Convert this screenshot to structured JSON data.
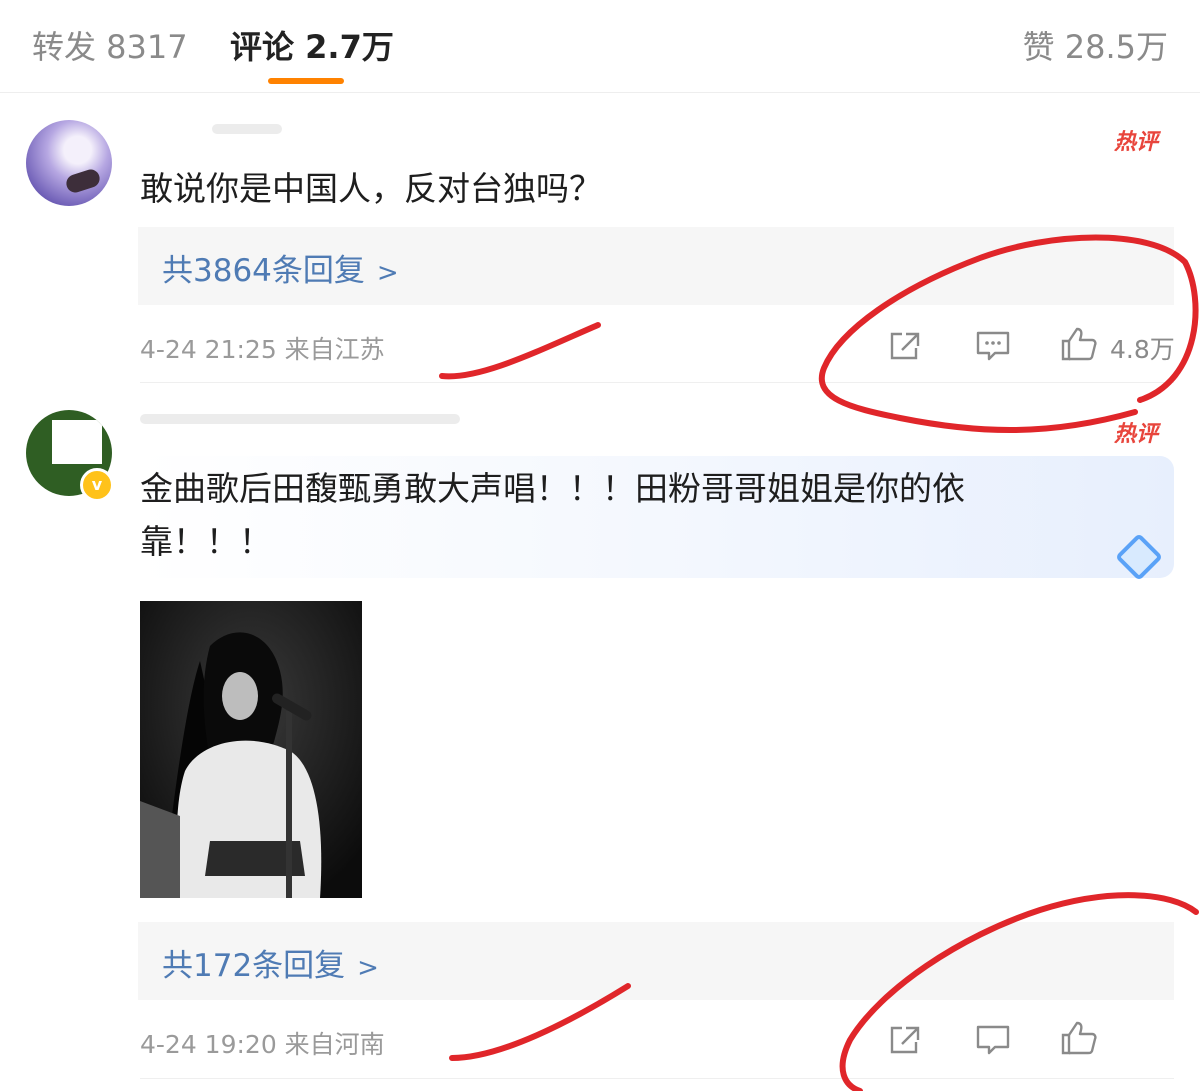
{
  "tabs": {
    "repost": "转发 8317",
    "comments": "评论 2.7万",
    "likes": "赞 28.5万"
  },
  "accent_color": "#ff8200",
  "link_color": "#4f7bb4",
  "annotation_color": "#e0262a",
  "comments": [
    {
      "badge": "热评",
      "text": "敢说你是中国人，反对台独吗？",
      "replies_label": "共3864条回复",
      "time_location": "4-24 21:25 来自江苏",
      "like_count": "4.8万"
    },
    {
      "badge": "热评",
      "text": "金曲歌后田馥甄勇敢大声唱！！！田粉哥哥姐姐是你的依靠！！！",
      "replies_label": "共172条回复",
      "time_location": "4-24 19:20 来自河南",
      "has_photo": true
    }
  ],
  "icons": [
    "share-icon",
    "comment-icon",
    "like-icon",
    "diamond-icon",
    "chevron-right-icon"
  ]
}
